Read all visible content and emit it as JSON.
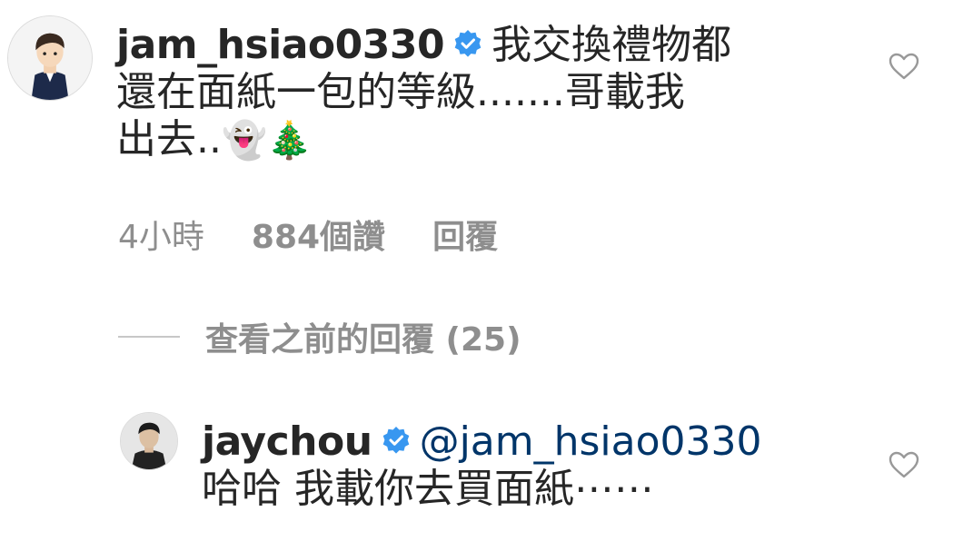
{
  "comments": [
    {
      "username": "jam_hsiao0330",
      "verified": true,
      "text_line1": "我交換禮物都",
      "text_line2": "還在面紙一包的等級.......哥載我",
      "text_line3": "出去..",
      "emoji1": "👻",
      "emoji2": "🎄",
      "time": "4小時",
      "likes": "884個讚",
      "reply_label": "回覆",
      "avatar_icon": "cartoon-man-avatar",
      "like_icon": "heart-outline-icon"
    },
    {
      "username": "jaychou",
      "verified": true,
      "mention": "@jam_hsiao0330",
      "text": "哈哈 我載你去買面紙⋯⋯",
      "avatar_icon": "photo-avatar",
      "like_icon": "heart-outline-icon"
    }
  ],
  "view_previous_replies": "查看之前的回覆 (25)",
  "colors": {
    "text": "#262626",
    "secondary": "#8e8e8e",
    "verified_blue": "#3897f0",
    "mention": "#003569"
  }
}
